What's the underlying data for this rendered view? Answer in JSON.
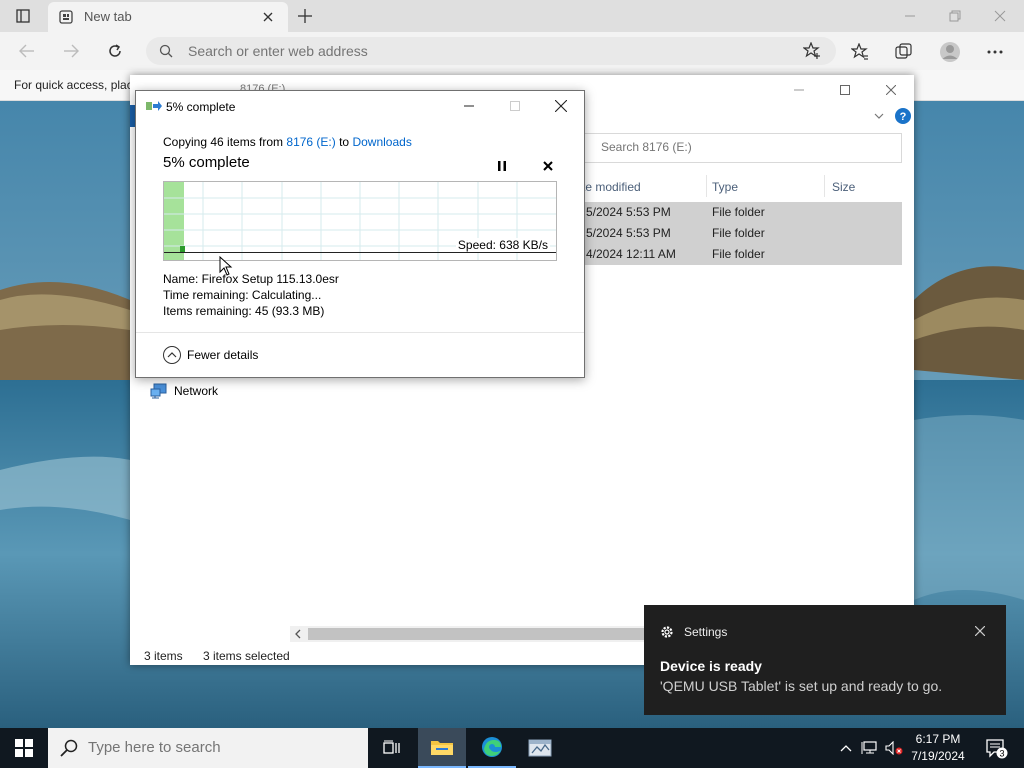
{
  "browser": {
    "tab_title": "New tab",
    "address_placeholder": "Search or enter web address",
    "favbar_text": "For quick access, plac"
  },
  "explorer": {
    "title": "8176 (E:)",
    "search_placeholder": "Search 8176 (E:)",
    "columns": [
      "te modified",
      "Type",
      "Size"
    ],
    "rows": [
      {
        "date": "5/2024 5:53 PM",
        "type": "File folder"
      },
      {
        "date": "5/2024 5:53 PM",
        "type": "File folder"
      },
      {
        "date": "4/2024 12:11 AM",
        "type": "File folder"
      }
    ],
    "nav_network": "Network",
    "status_items": "3 items",
    "status_selected": "3 items selected"
  },
  "dialog": {
    "title": "5% complete",
    "copying_prefix": "Copying 46 items from",
    "source": "8176 (E:)",
    "to_word": "to",
    "destination": "Downloads",
    "big_status": "5% complete",
    "progress_fraction": 0.05,
    "speed": "Speed: 638 KB/s",
    "name_line": "Name:  Firefox Setup 115.13.0esr",
    "time_line": "Time remaining:  Calculating...",
    "items_line": "Items remaining:  45 (93.3 MB)",
    "fewer_details": "Fewer details"
  },
  "toast": {
    "app": "Settings",
    "heading": "Device is ready",
    "body": "'QEMU USB Tablet' is set up and ready to go."
  },
  "taskbar": {
    "search_placeholder": "Type here to search",
    "time": "6:17 PM",
    "date": "7/19/2024",
    "notification_count": "3"
  }
}
